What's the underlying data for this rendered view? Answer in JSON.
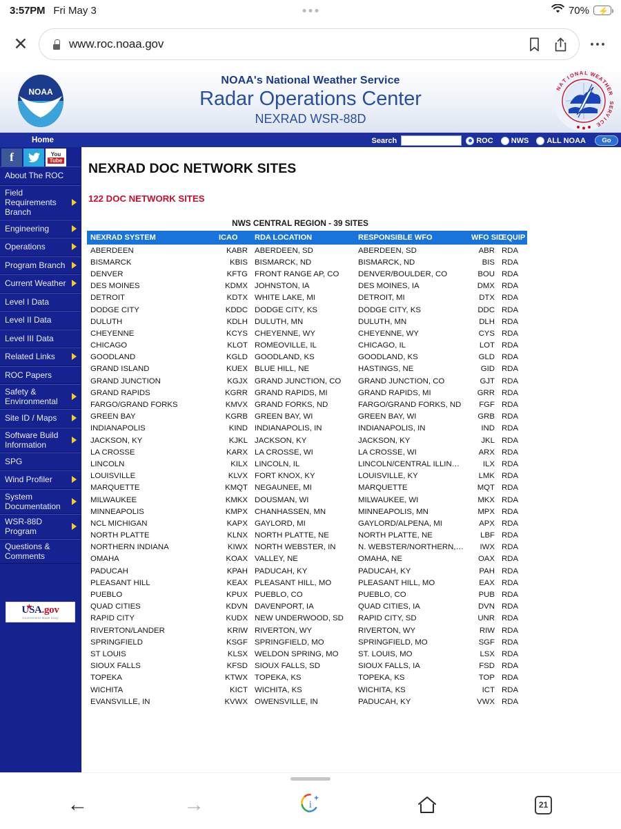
{
  "status_bar": {
    "time": "3:57PM",
    "date": "Fri May 3",
    "battery_percent": "70%",
    "wifi_icon": "wifi-icon",
    "battery_icon": "battery-charging-icon"
  },
  "browser": {
    "close_label": "✕",
    "url": "www.roc.noaa.gov",
    "lock_icon": "lock-icon",
    "bookmark_icon": "bookmark-icon",
    "share_icon": "share-icon",
    "menu_icon": "overflow-menu-icon"
  },
  "site_header": {
    "line1": "NOAA's National Weather Service",
    "line2": "Radar Operations Center",
    "line3": "NEXRAD WSR-88D",
    "noaa_logo_text": "NOAA",
    "nws_seal_text": "NATIONAL WEATHER SERVICE"
  },
  "nav": {
    "home_label": "Home",
    "search_label": "Search",
    "search_value": "",
    "search_placeholder": "",
    "radios": [
      {
        "label": "ROC",
        "selected": true
      },
      {
        "label": "NWS",
        "selected": false
      },
      {
        "label": "ALL NOAA",
        "selected": false
      }
    ],
    "go_label": "Go"
  },
  "sidebar": {
    "social": [
      {
        "name": "facebook",
        "glyph": "f"
      },
      {
        "name": "twitter",
        "glyph": "🐦"
      },
      {
        "name": "youtube",
        "line1": "You",
        "line2": "Tube"
      }
    ],
    "items": [
      {
        "label": "About The ROC",
        "has_arrow": false
      },
      {
        "label": "Field Requirements Branch",
        "has_arrow": true
      },
      {
        "label": "Engineering",
        "has_arrow": true
      },
      {
        "label": "Operations",
        "has_arrow": true
      },
      {
        "label": "Program Branch",
        "has_arrow": true
      },
      {
        "label": "Current Weather",
        "has_arrow": true
      },
      {
        "label": "Level I Data",
        "has_arrow": false
      },
      {
        "label": "Level II Data",
        "has_arrow": false
      },
      {
        "label": "Level III Data",
        "has_arrow": false
      },
      {
        "label": "Related Links",
        "has_arrow": true
      },
      {
        "label": "ROC Papers",
        "has_arrow": false
      },
      {
        "label": "Safety & Environmental",
        "has_arrow": true
      },
      {
        "label": "Site ID / Maps",
        "has_arrow": true
      },
      {
        "label": "Software Build Information",
        "has_arrow": true
      },
      {
        "label": "SPG",
        "has_arrow": false
      },
      {
        "label": "Wind Profiler",
        "has_arrow": true
      },
      {
        "label": "System Documentation",
        "has_arrow": true
      },
      {
        "label": "WSR-88D Program",
        "has_arrow": true
      },
      {
        "label": "Questions & Comments",
        "has_arrow": false
      }
    ],
    "usagov": {
      "brand": "USA",
      "suffix": ".gov",
      "tagline": "Government Made Easy"
    }
  },
  "main": {
    "page_title": "NEXRAD DOC NETWORK SITES",
    "sites_count": "122 DOC NETWORK SITES",
    "region_title": "NWS CENTRAL REGION - 39 SITES",
    "columns": [
      "NEXRAD SYSTEM",
      "ICAO",
      "RDA LOCATION",
      "RESPONSIBLE WFO",
      "WFO SID",
      "EQUIP"
    ],
    "rows": [
      [
        "ABERDEEN",
        "KABR",
        "ABERDEEN, SD",
        "ABERDEEN, SD",
        "ABR",
        "RDA"
      ],
      [
        "BISMARCK",
        "KBIS",
        "BISMARCK, ND",
        "BISMARCK, ND",
        "BIS",
        "RDA"
      ],
      [
        "DENVER",
        "KFTG",
        "FRONT RANGE AP, CO",
        "DENVER/BOULDER, CO",
        "BOU",
        "RDA"
      ],
      [
        "DES MOINES",
        "KDMX",
        "JOHNSTON, IA",
        "DES MOINES, IA",
        "DMX",
        "RDA"
      ],
      [
        "DETROIT",
        "KDTX",
        "WHITE LAKE, MI",
        "DETROIT, MI",
        "DTX",
        "RDA"
      ],
      [
        "DODGE CITY",
        "KDDC",
        "DODGE CITY, KS",
        "DODGE CITY, KS",
        "DDC",
        "RDA"
      ],
      [
        "DULUTH",
        "KDLH",
        "DULUTH, MN",
        "DULUTH, MN",
        "DLH",
        "RDA"
      ],
      [
        "CHEYENNE",
        "KCYS",
        "CHEYENNE, WY",
        "CHEYENNE, WY",
        "CYS",
        "RDA"
      ],
      [
        "CHICAGO",
        "KLOT",
        "ROMEOVILLE, IL",
        "CHICAGO, IL",
        "LOT",
        "RDA"
      ],
      [
        "GOODLAND",
        "KGLD",
        "GOODLAND, KS",
        "GOODLAND, KS",
        "GLD",
        "RDA"
      ],
      [
        "GRAND ISLAND",
        "KUEX",
        "BLUE HILL, NE",
        "HASTINGS, NE",
        "GID",
        "RDA"
      ],
      [
        "GRAND JUNCTION",
        "KGJX",
        "GRAND JUNCTION, CO",
        "GRAND JUNCTION, CO",
        "GJT",
        "RDA"
      ],
      [
        "GRAND RAPIDS",
        "KGRR",
        "GRAND RAPIDS, MI",
        "GRAND RAPIDS, MI",
        "GRR",
        "RDA"
      ],
      [
        "FARGO/GRAND FORKS",
        "KMVX",
        "GRAND FORKS, ND",
        "FARGO/GRAND FORKS, ND",
        "FGF",
        "RDA"
      ],
      [
        "GREEN BAY",
        "KGRB",
        "GREEN BAY, WI",
        "GREEN BAY, WI",
        "GRB",
        "RDA"
      ],
      [
        "INDIANAPOLIS",
        "KIND",
        "INDIANAPOLIS, IN",
        "INDIANAPOLIS, IN",
        "IND",
        "RDA"
      ],
      [
        "JACKSON, KY",
        "KJKL",
        "JACKSON, KY",
        "JACKSON, KY",
        "JKL",
        "RDA"
      ],
      [
        "LA CROSSE",
        "KARX",
        "LA CROSSE, WI",
        "LA CROSSE, WI",
        "ARX",
        "RDA"
      ],
      [
        "LINCOLN",
        "KILX",
        "LINCOLN, IL",
        "LINCOLN/CENTRAL ILLINOIS, IL",
        "ILX",
        "RDA"
      ],
      [
        "LOUISVILLE",
        "KLVX",
        "FORT KNOX, KY",
        "LOUISVILLE, KY",
        "LMK",
        "RDA"
      ],
      [
        "MARQUETTE",
        "KMQT",
        "NEGAUNEE, MI",
        "MARQUETTE",
        "MQT",
        "RDA"
      ],
      [
        "MILWAUKEE",
        "KMKX",
        "DOUSMAN, WI",
        "MILWAUKEE, WI",
        "MKX",
        "RDA"
      ],
      [
        "MINNEAPOLIS",
        "KMPX",
        "CHANHASSEN, MN",
        "MINNEAPOLIS, MN",
        "MPX",
        "RDA"
      ],
      [
        "NCL MICHIGAN",
        "KAPX",
        "GAYLORD, MI",
        "GAYLORD/ALPENA, MI",
        "APX",
        "RDA"
      ],
      [
        "NORTH PLATTE",
        "KLNX",
        "NORTH PLATTE, NE",
        "NORTH PLATTE, NE",
        "LBF",
        "RDA"
      ],
      [
        "NORTHERN INDIANA",
        "KIWX",
        "NORTH WEBSTER, IN",
        "N. WEBSTER/NORTHERN, IN",
        "IWX",
        "RDA"
      ],
      [
        "OMAHA",
        "KOAX",
        "VALLEY, NE",
        "OMAHA, NE",
        "OAX",
        "RDA"
      ],
      [
        "PADUCAH",
        "KPAH",
        "PADUCAH, KY",
        "PADUCAH, KY",
        "PAH",
        "RDA"
      ],
      [
        "PLEASANT HILL",
        "KEAX",
        "PLEASANT HILL, MO",
        "PLEASANT HILL, MO",
        "EAX",
        "RDA"
      ],
      [
        "PUEBLO",
        "KPUX",
        "PUEBLO, CO",
        "PUEBLO, CO",
        "PUB",
        "RDA"
      ],
      [
        "QUAD CITIES",
        "KDVN",
        "DAVENPORT, IA",
        "QUAD CITIES, IA",
        "DVN",
        "RDA"
      ],
      [
        "RAPID CITY",
        "KUDX",
        "NEW UNDERWOOD, SD",
        "RAPID CITY, SD",
        "UNR",
        "RDA"
      ],
      [
        "RIVERTON/LANDER",
        "KRIW",
        "RIVERTON, WY",
        "RIVERTON, WY",
        "RIW",
        "RDA"
      ],
      [
        "SPRINGFIELD",
        "KSGF",
        "SPRINGFIELD, MO",
        "SPRINGFIELD, MO",
        "SGF",
        "RDA"
      ],
      [
        "ST LOUIS",
        "KLSX",
        "WELDON SPRING, MO",
        "ST. LOUIS, MO",
        "LSX",
        "RDA"
      ],
      [
        "SIOUX FALLS",
        "KFSD",
        "SIOUX FALLS, SD",
        "SIOUX FALLS, IA",
        "FSD",
        "RDA"
      ],
      [
        "TOPEKA",
        "KTWX",
        "TOPEKA, KS",
        "TOPEKA, KS",
        "TOP",
        "RDA"
      ],
      [
        "WICHITA",
        "KICT",
        "WICHITA, KS",
        "WICHITA, KS",
        "ICT",
        "RDA"
      ],
      [
        "EVANSVILLE, IN",
        "KVWX",
        "OWENSVILLE, IN",
        "PADUCAH, KY",
        "VWX",
        "RDA"
      ]
    ]
  },
  "bottom_bar": {
    "back_icon": "back-arrow-icon",
    "forward_icon": "forward-arrow-icon",
    "assistant_icon": "google-assistant-icon",
    "home_icon": "home-icon",
    "tab_count": "21"
  },
  "colors": {
    "nav_blue": "#16228f",
    "table_header_blue": "#1874d8",
    "accent_red": "#c8102e",
    "header_text_blue": "#2a4fa0"
  }
}
